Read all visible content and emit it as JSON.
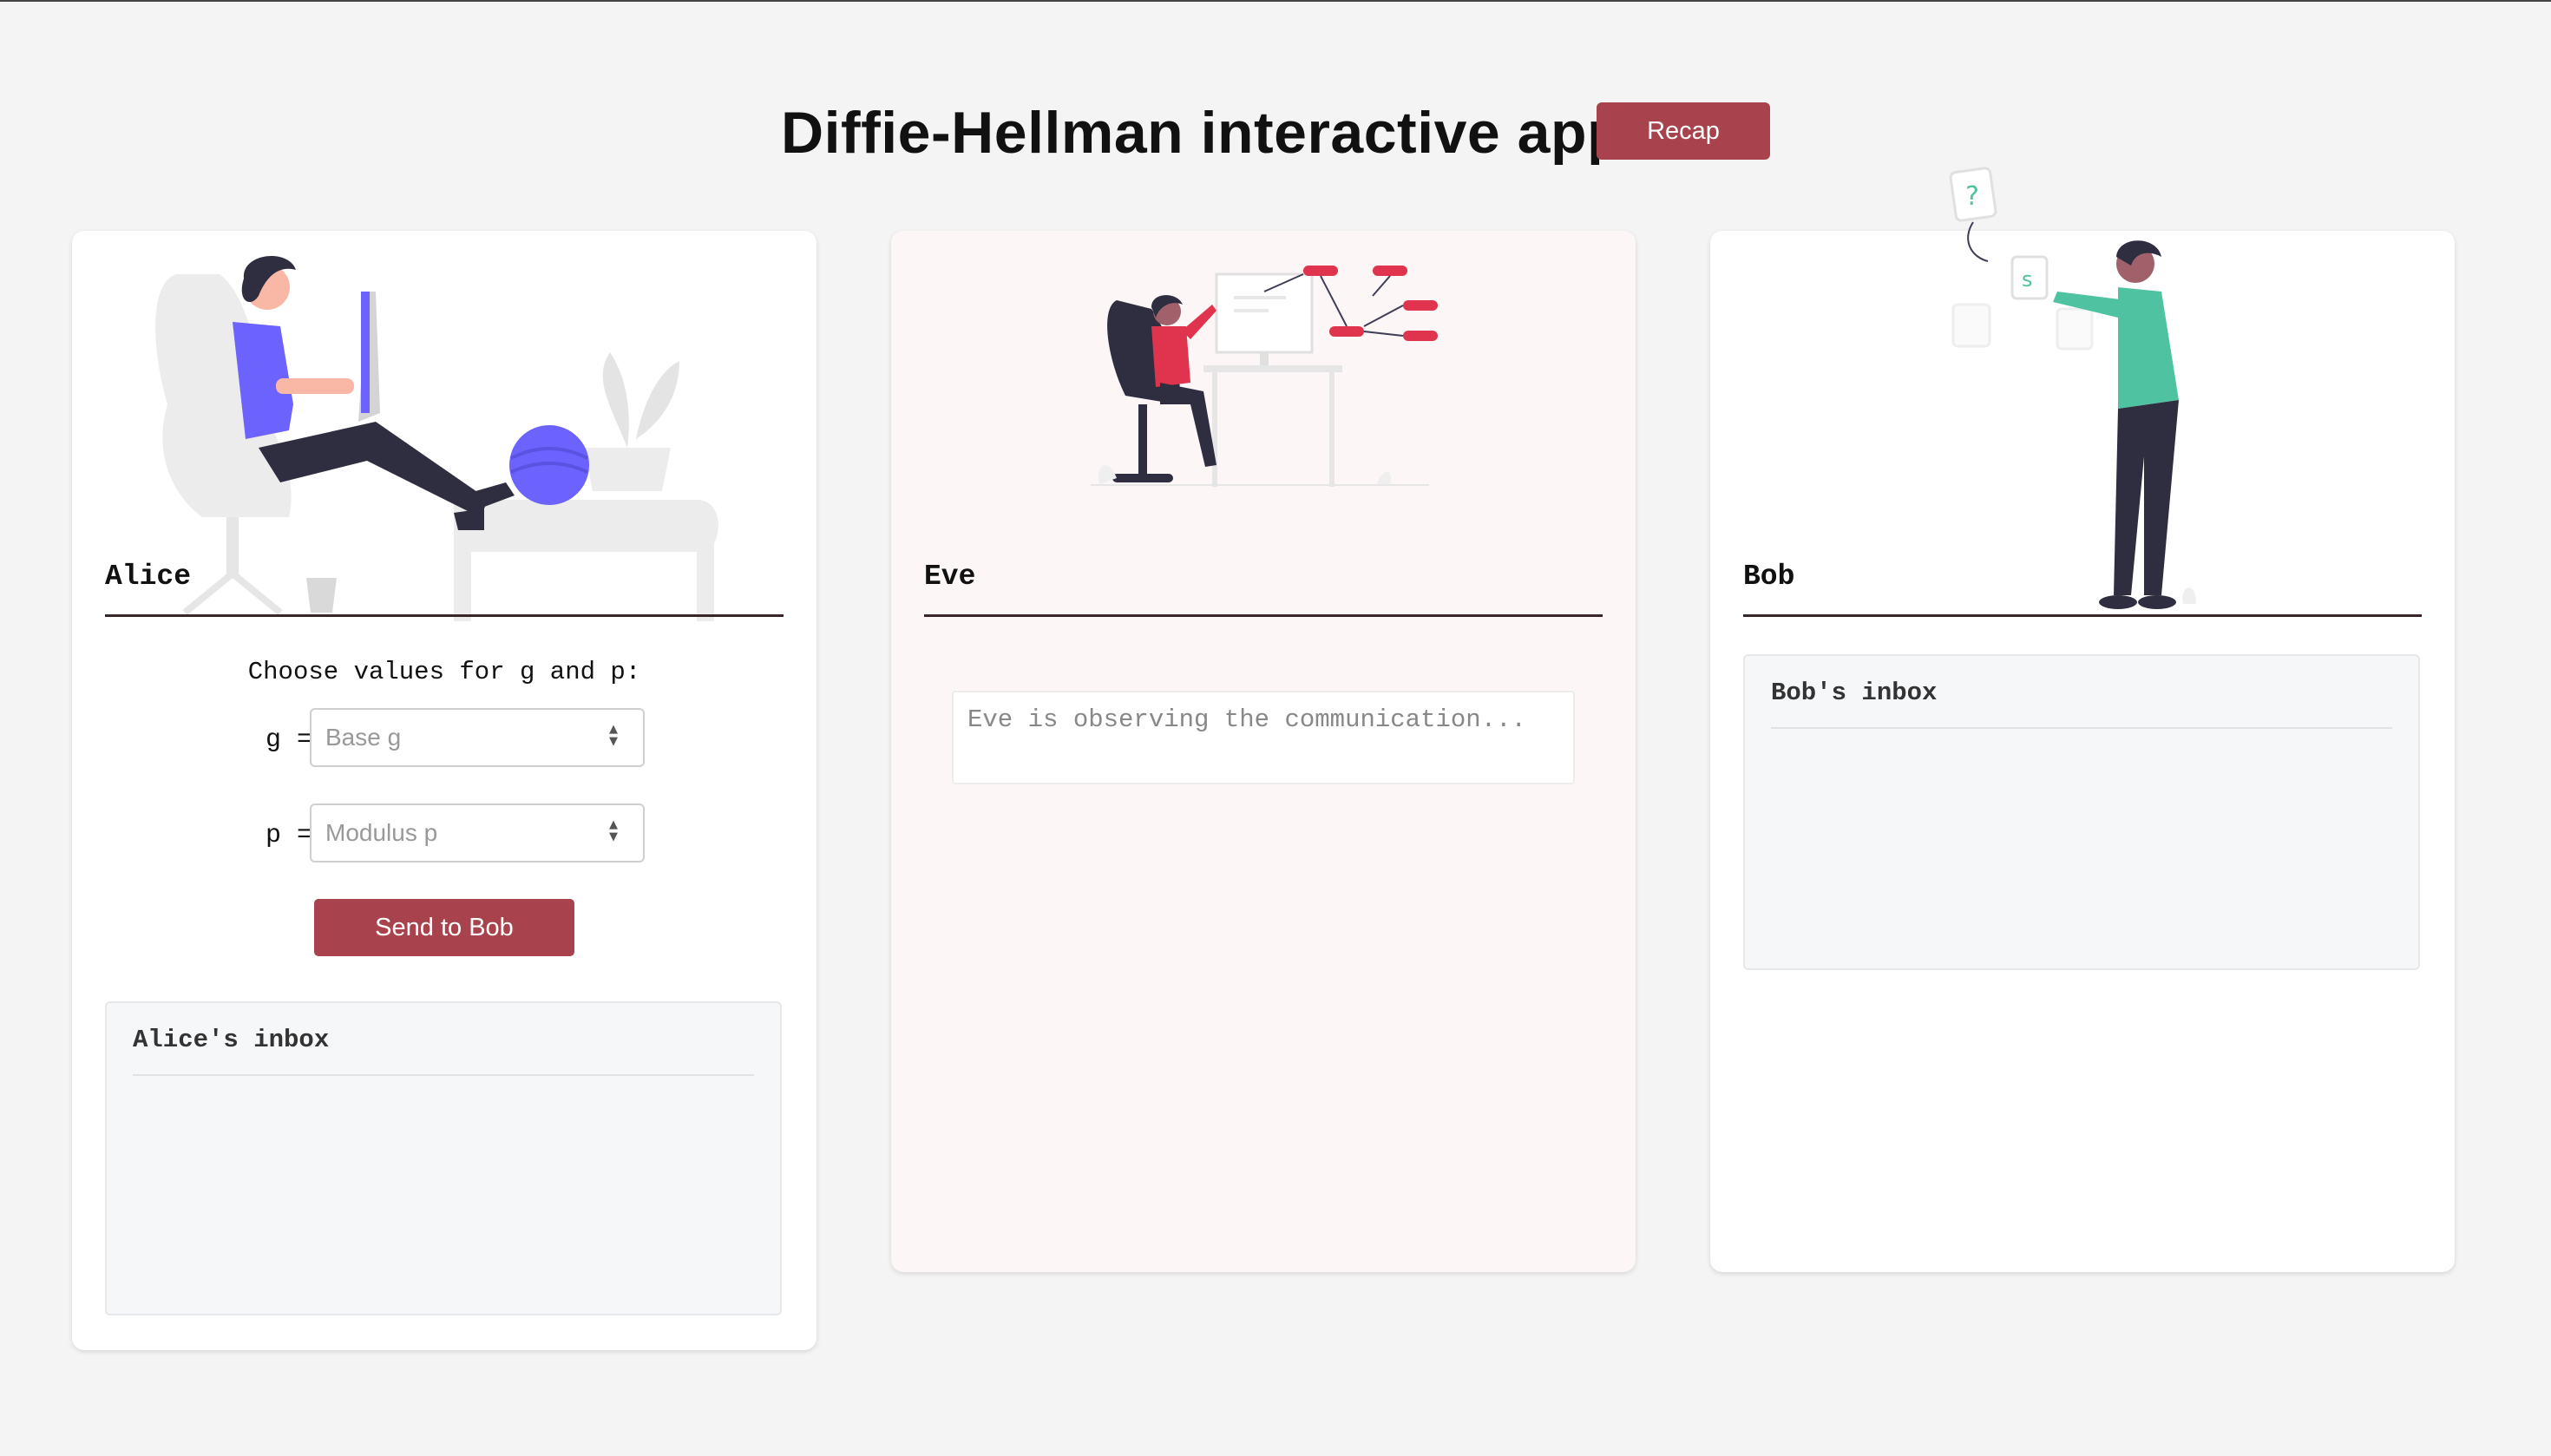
{
  "header": {
    "title": "Diffie-Hellman interactive app",
    "recap_label": "Recap"
  },
  "alice": {
    "name": "Alice",
    "prompt": "Choose values for g and p:",
    "g_label": "g =",
    "g_placeholder": "Base g",
    "g_value": "",
    "p_label": "p =",
    "p_placeholder": "Modulus p",
    "p_value": "",
    "send_label": "Send to Bob",
    "inbox_title": "Alice's inbox"
  },
  "eve": {
    "name": "Eve",
    "status": "Eve is observing the communication..."
  },
  "bob": {
    "name": "Bob",
    "inbox_title": "Bob's inbox"
  },
  "colors": {
    "accent_button": "#a8434d",
    "page_background": "#f4f4f4",
    "eve_card_background": "#fcf6f6",
    "illustration_purple": "#6c63ff",
    "illustration_red": "#e0344e",
    "illustration_green": "#4fc3a1",
    "illustration_dark": "#2f2e41"
  },
  "icons": {
    "spinner": "number-spinner-icon"
  }
}
